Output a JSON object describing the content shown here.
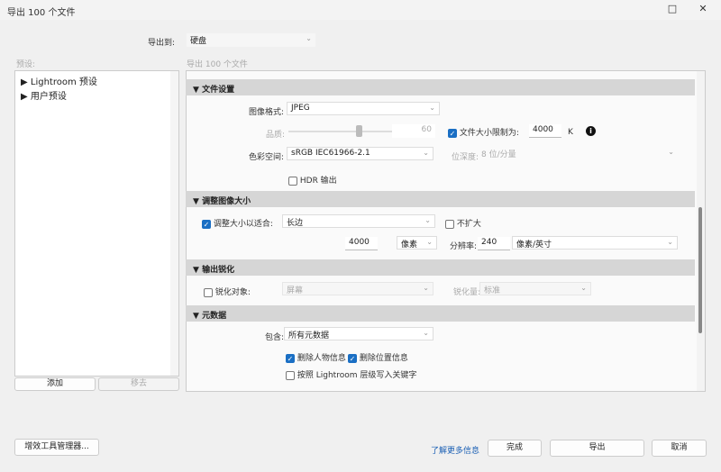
{
  "window": {
    "title": "导出 100 个文件",
    "maximize_icon": "□",
    "close_icon": "✕"
  },
  "export_to": {
    "label": "导出到:",
    "value": "硬盘"
  },
  "presets": {
    "label": "预设:",
    "items": [
      {
        "label": "Lightroom 预设"
      },
      {
        "label": "用户预设"
      }
    ],
    "add": "添加",
    "remove": "移去"
  },
  "main": {
    "subtitle": "导出 100 个文件"
  },
  "file_settings": {
    "header": "文件设置",
    "format_label": "图像格式:",
    "format": "JPEG",
    "quality_label": "品质:",
    "quality": "60",
    "quality_level": 60,
    "limit_label": "文件大小限制为:",
    "limit_checked": true,
    "limit_value": "4000",
    "limit_unit": "K",
    "colorspace_label": "色彩空间:",
    "colorspace": "sRGB IEC61966-2.1",
    "bitdepth_label": "位深度:",
    "bitdepth": "8 位/分量",
    "hdr_label": "HDR 输出",
    "hdr_checked": false
  },
  "resize": {
    "header": "调整图像大小",
    "fit_label": "调整大小以适合:",
    "fit_checked": true,
    "fit": "长边",
    "no_enlarge": "不扩大",
    "size": "4000",
    "unit": "像素",
    "res_label": "分辨率:",
    "res": "240",
    "res_unit": "像素/英寸"
  },
  "sharpen": {
    "header": "输出锐化",
    "target_label": "锐化对象:",
    "target": "屏幕",
    "amount_label": "锐化量:",
    "amount": "标准"
  },
  "metadata": {
    "header": "元数据",
    "include_label": "包含:",
    "include": "所有元数据",
    "remove_person": "删除人物信息",
    "remove_location": "删除位置信息",
    "keywords": "按照 Lightroom 层级写入关键字"
  },
  "footer": {
    "plugin_manager": "增效工具管理器...",
    "learn_more": "了解更多信息",
    "done": "完成",
    "export": "导出",
    "cancel": "取消"
  },
  "colors": {
    "accent": "#1a6fc4",
    "link": "#1a5fb4"
  }
}
